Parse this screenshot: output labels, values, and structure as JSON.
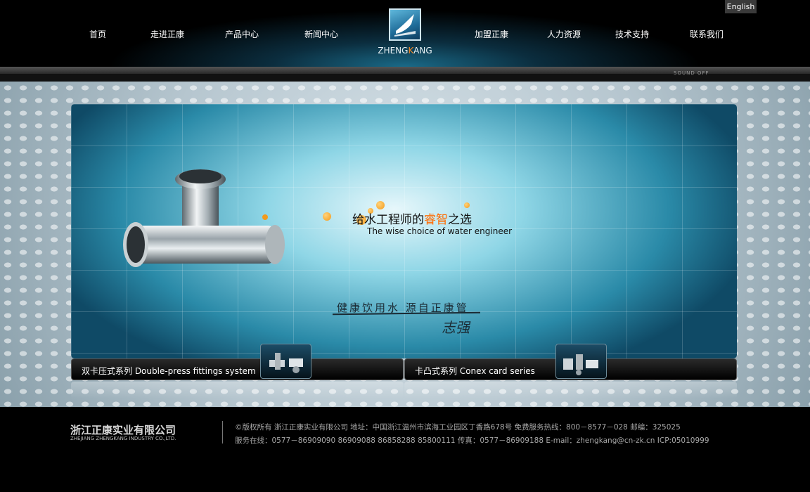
{
  "header": {
    "lang_button": "English",
    "nav": [
      "首页",
      "走进正康",
      "产品中心",
      "新闻中心",
      "加盟正康",
      "人力资源",
      "技术支持",
      "联系我们"
    ],
    "logo_prefix": "ZHENG",
    "logo_k": "K",
    "logo_suffix": "ANG",
    "sound_toggle": "SOUND OFF"
  },
  "banner": {
    "slogan_cn_pre": "给水工程师的",
    "slogan_cn_hl": "睿智",
    "slogan_cn_post": "之选",
    "slogan_en": "The wise choice of water engineer",
    "motto": "健康饮用水 源自正康管",
    "signature": "志强"
  },
  "tabs": [
    {
      "label": "双卡压式系列  Double-press fittings system"
    },
    {
      "label": "卡凸式系列  Conex card series"
    }
  ],
  "footer": {
    "company_cn": "浙江正康实业有限公司",
    "company_en": "ZHEJIANG ZHENGKANG INDUSTRY CO.,LTD.",
    "line1": "©版权所有  浙江正康实业有限公司  地址：中国浙江温州市滨海工业园区丁香路678号  免费服务热线：800－8577－028  邮编：325025",
    "line2": "服务在线：0577－86909090 86909088 86858288 85800111 传真：0577－86909188  E-mail：zhengkang@cn-zk.cn  ICP:05010999"
  },
  "colors": {
    "accent": "#ff6a00",
    "header_glow": "#1a6a88"
  }
}
